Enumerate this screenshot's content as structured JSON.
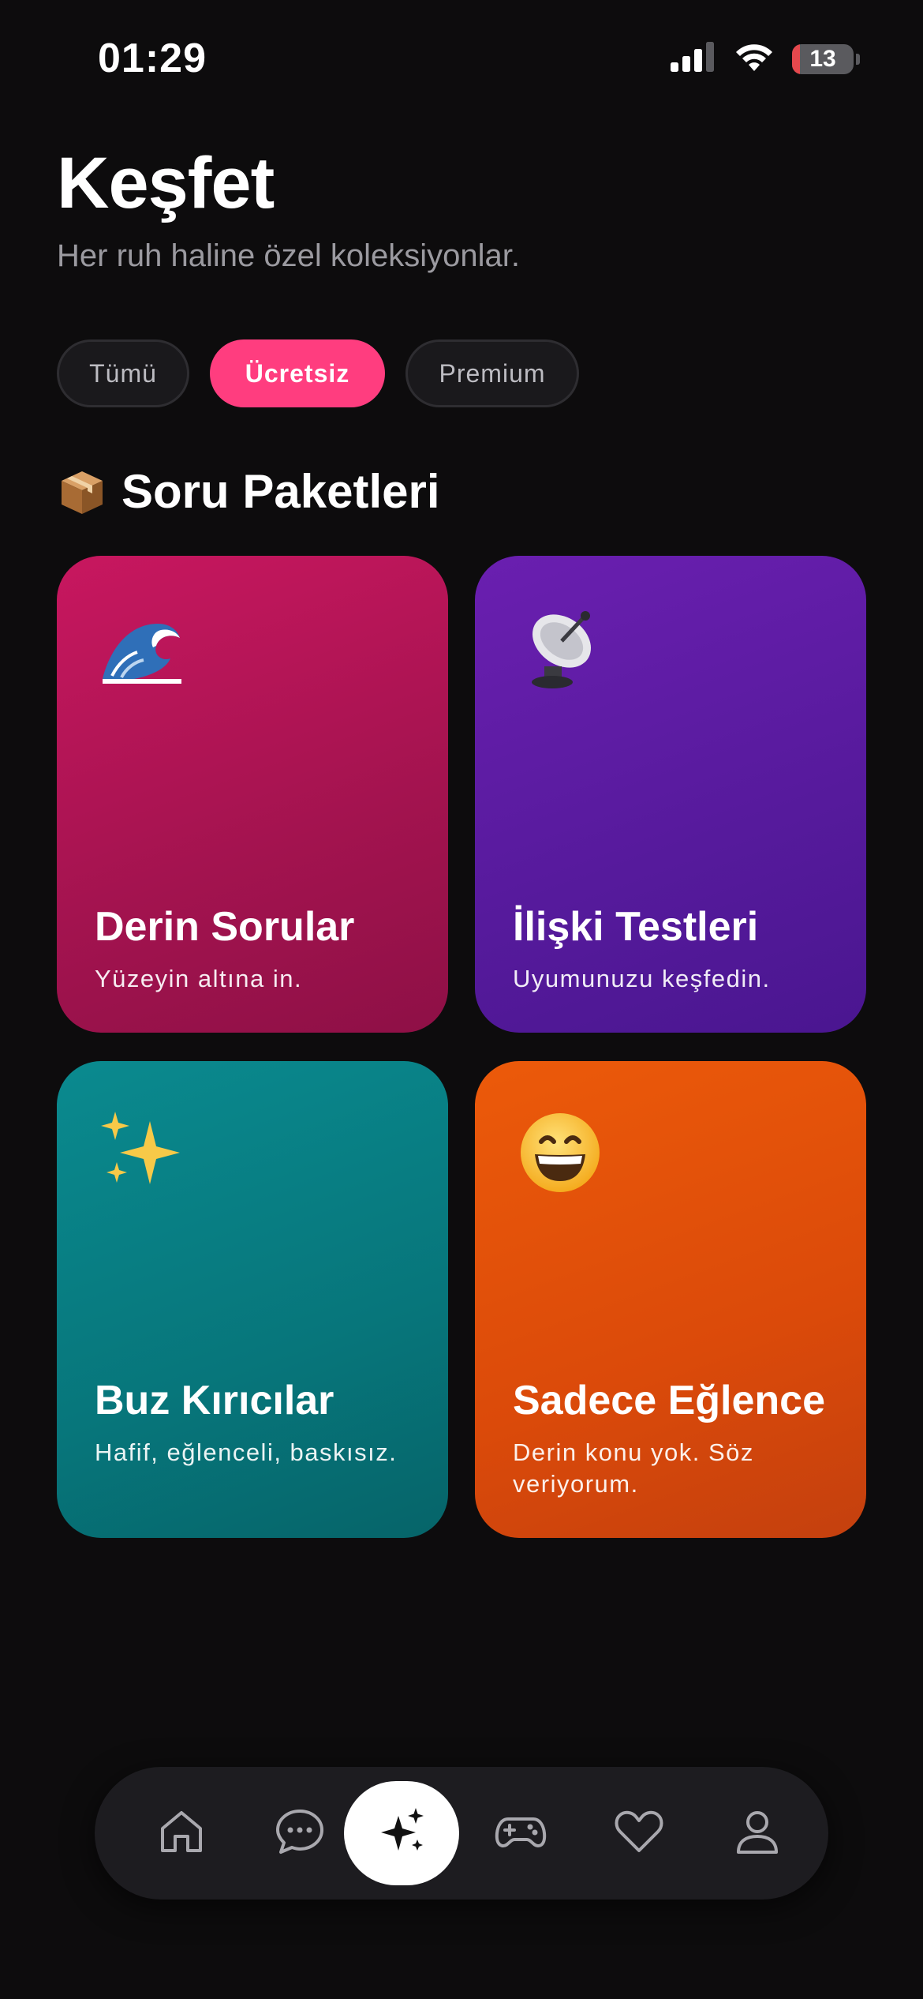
{
  "status_bar": {
    "time": "01:29",
    "battery_level": "13"
  },
  "header": {
    "title": "Keşfet",
    "subtitle": "Her ruh haline özel koleksiyonlar."
  },
  "filters": {
    "all_label": "Tümü",
    "free_label": "Ücretsiz",
    "premium_label": "Premium",
    "selected": "Ücretsiz"
  },
  "section": {
    "icon": "package-icon",
    "title": "Soru Paketleri"
  },
  "cards": [
    {
      "icon": "wave-icon",
      "title": "Derin Sorular",
      "description": "Yüzeyin altına in.",
      "color": "#b2165a"
    },
    {
      "icon": "satellite-dish-icon",
      "title": "İlişki Testleri",
      "description": "Uyumunuzu keşfedin.",
      "color": "#5b1ca0"
    },
    {
      "icon": "sparkles-icon",
      "title": "Buz Kırıcılar",
      "description": "Hafif, eğlenceli, baskısız.",
      "color": "#087b80"
    },
    {
      "icon": "grinning-face-icon",
      "title": "Sadece Eğlence",
      "description": "Derin konu yok. Söz veriyorum.",
      "color": "#e04e0a"
    }
  ],
  "tab_bar": {
    "items": [
      "home-icon",
      "chat-icon",
      "sparkles-icon",
      "gamepad-icon",
      "heart-icon",
      "profile-icon"
    ],
    "active": "sparkles-icon"
  },
  "colors": {
    "background": "#0d0c0d",
    "accent": "#ff3d7f",
    "chip_background": "#1a191c",
    "tab_bar_background": "#1d1c20"
  }
}
